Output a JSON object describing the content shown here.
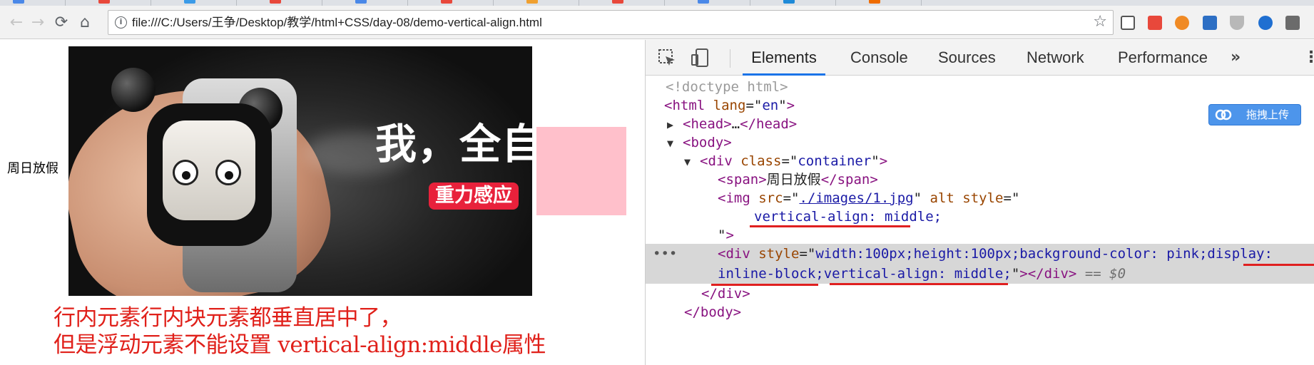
{
  "browser": {
    "url": "file:///C:/Users/王争/Desktop/教学/html+CSS/day-08/demo-vertical-align.html",
    "nav": {
      "back": "←",
      "forward": "→",
      "reload": "⟳",
      "home": "⌂",
      "info": "i",
      "bookmark": "☆"
    },
    "tab_accents": [
      "#4a88e8",
      "#e8483b",
      "#3b9be8",
      "#e8483b",
      "#4a88e8",
      "#e8483b",
      "#f0a030",
      "#e8483b",
      "#4a88e8",
      "#1f8ad8",
      "#ef6c00"
    ],
    "extension_icons": [
      "qr-code-icon",
      "fe-icon",
      "link-icon",
      "s-icon",
      "v-icon",
      "q-icon",
      "grid-icon"
    ]
  },
  "page": {
    "side_text": "周日放假",
    "banner": {
      "slogan": "我，全自动",
      "badge": "重力感应"
    },
    "note_lines": [
      "行内元素行内块元素都垂直居中了，",
      "但是浮动元素不能设置 vertical-align:middle属性"
    ]
  },
  "devtools": {
    "tabs": [
      "Elements",
      "Console",
      "Sources",
      "Network",
      "Performance"
    ],
    "active_tab": "Elements",
    "more_label": "»",
    "menu_label": "⋮",
    "upload_button": "拖拽上传",
    "dom": {
      "doctype": "<!doctype html>",
      "html_open": {
        "tag": "html",
        "attr": "lang",
        "value": "en"
      },
      "head": {
        "tag": "head",
        "collapsed": "…"
      },
      "body": "body",
      "container": {
        "tag": "div",
        "attr": "class",
        "value": "container"
      },
      "span": {
        "tag": "span",
        "text": "周日放假"
      },
      "img": {
        "tag": "img",
        "src_attr": "src",
        "src": "./images/1.jpg",
        "alt_attr": "alt",
        "style_attr": "style",
        "style_value": "vertical-align:  middle;"
      },
      "selected_div": {
        "tag": "div",
        "style_attr": "style",
        "style_line1": "width:100px;height:100px;background-color: pink;display:",
        "style_line2": "inline-block;vertical-align:  middle;",
        "console_ref": "== $0",
        "ellipsis": "•••"
      },
      "div_close": "div",
      "body_close": "body"
    }
  }
}
